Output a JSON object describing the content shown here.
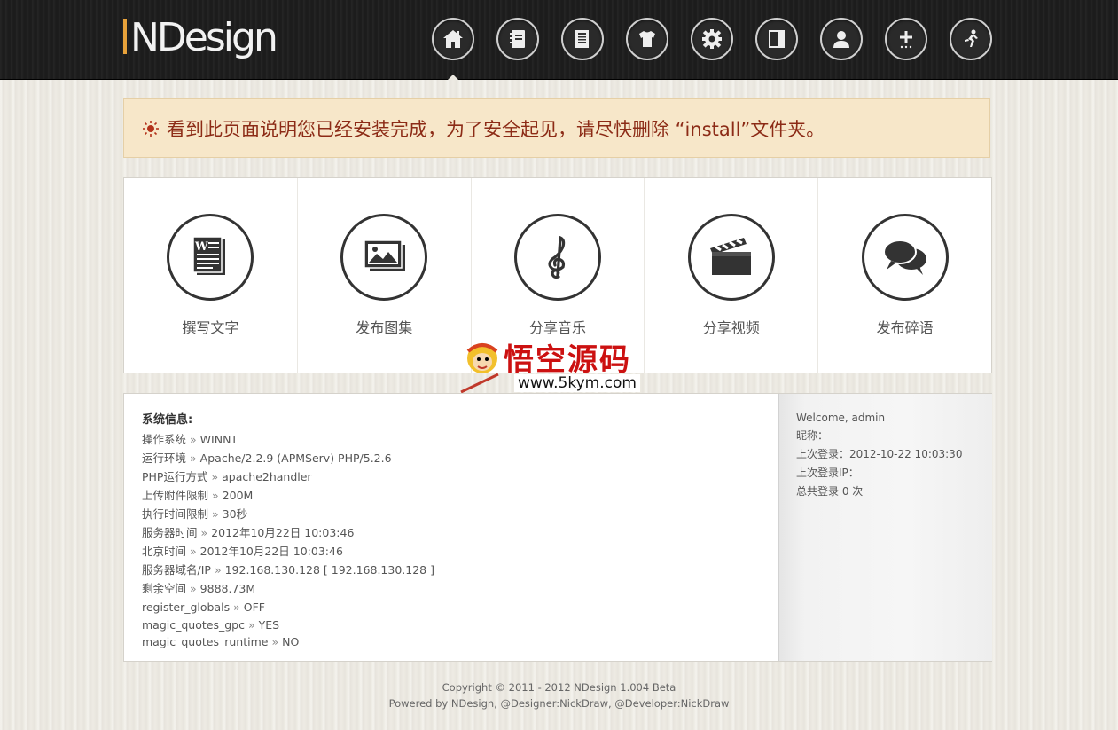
{
  "header": {
    "logo_text": "NDesign",
    "nav": [
      {
        "icon": "home-icon"
      },
      {
        "icon": "notebook-icon"
      },
      {
        "icon": "document-icon"
      },
      {
        "icon": "shirt-icon"
      },
      {
        "icon": "gear-icon"
      },
      {
        "icon": "panel-icon"
      },
      {
        "icon": "user-icon"
      },
      {
        "icon": "plus-icon"
      },
      {
        "icon": "logout-runner-icon"
      }
    ]
  },
  "notice": {
    "text": "看到此页面说明您已经安装完成，为了安全起见，请尽快删除 “install”文件夹。",
    "color": "#8c2b16",
    "icon": "sun-icon"
  },
  "actions": [
    {
      "label": "撰写文字",
      "icon": "write-text-icon"
    },
    {
      "label": "发布图集",
      "icon": "gallery-icon"
    },
    {
      "label": "分享音乐",
      "icon": "music-clef-icon"
    },
    {
      "label": "分享视频",
      "icon": "clapperboard-icon"
    },
    {
      "label": "发布碎语",
      "icon": "chat-bubbles-icon"
    }
  ],
  "watermark": {
    "text": "悟空源码",
    "url": "www.5kym.com"
  },
  "system": {
    "title": "系统信息:",
    "rows": [
      {
        "k": "操作系统",
        "v": "WINNT"
      },
      {
        "k": "运行环境",
        "v": "Apache/2.2.9 (APMServ) PHP/5.2.6"
      },
      {
        "k": "PHP运行方式",
        "v": "apache2handler"
      },
      {
        "k": "上传附件限制",
        "v": "200M"
      },
      {
        "k": "执行时间限制",
        "v": "30秒"
      },
      {
        "k": "服务器时间",
        "v": "2012年10月22日 10:03:46"
      },
      {
        "k": "北京时间",
        "v": "2012年10月22日 10:03:46"
      },
      {
        "k": "服务器域名/IP",
        "v": "192.168.130.128 [ 192.168.130.128 ]"
      },
      {
        "k": "剩余空间",
        "v": "9888.73M"
      },
      {
        "k": "register_globals",
        "v": "OFF"
      },
      {
        "k": "magic_quotes_gpc",
        "v": "YES"
      },
      {
        "k": "magic_quotes_runtime",
        "v": "NO"
      }
    ]
  },
  "user": {
    "welcome": "Welcome, admin",
    "nickname": "昵称：",
    "last_login": "上次登录：2012-10-22 10:03:30",
    "last_ip": "上次登录IP：",
    "total_login": "总共登录  0 次"
  },
  "footer": {
    "copyright": "Copyright © 2011 - 2012 NDesign 1.004 Beta",
    "powered": "Powered by NDesign, @Designer:NickDraw, @Developer:NickDraw"
  },
  "sep": "»"
}
